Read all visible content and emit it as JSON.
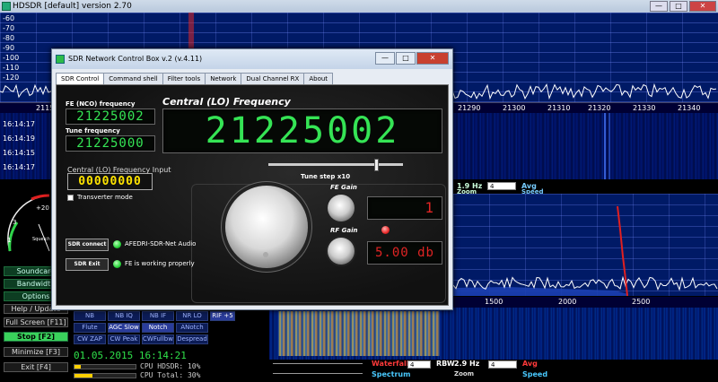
{
  "hdsdr": {
    "title": "HDSDR [default]  version 2.70",
    "db_labels": [
      "-60",
      "-70",
      "-80",
      "-90",
      "-100",
      "-110",
      "-120"
    ],
    "top_scale": [
      "2115",
      "21290",
      "21300",
      "21310",
      "21320",
      "21330",
      "21340"
    ],
    "wf_times": [
      "16:14:17",
      "16:14:19",
      "16:14:15",
      "16:14:17"
    ],
    "rbw_top": "1.9 Hz",
    "avg_label": "Avg",
    "zoom_label": "Zoom",
    "speed_label": "Speed",
    "bottom_scale": [
      "1500",
      "2000",
      "2500"
    ],
    "waterfall_label": "Waterfall",
    "spectrum_label": "Spectrum",
    "rbw_label": "RBW",
    "rbw_bottom": "2.9 Hz",
    "rbw_select": "4",
    "avg_select": "4",
    "small_select": "4"
  },
  "left_panel": {
    "buttons": [
      "Soundcard",
      "Bandwidth",
      "Options",
      "Help / Update",
      "Full Screen [F11]",
      "Stop [F2]",
      "Minimize [F3]",
      "Exit [F4]"
    ],
    "modes_row1": [
      "NB",
      "NB IQ",
      "NB IF",
      "NR LO",
      "RIF +5"
    ],
    "modes_row2": [
      "Flute",
      "AGC Slow",
      "Notch",
      "ANotch"
    ],
    "modes_row3": [
      "CW ZAP",
      "CW Peak",
      "CWFullbw",
      "Despread"
    ],
    "datetime": "01.05.2015 16:14:21",
    "cpu_hdsdr": "CPU HDSDR: 10%",
    "cpu_total": "CPU Total: 30%",
    "smeter_labels": [
      "1",
      "3",
      "+20",
      "Squelch"
    ],
    "cpu_hdsdr_pct": 10,
    "cpu_total_pct": 30
  },
  "dialog": {
    "title": "SDR Network Control Box v.2 (v.4.11)",
    "minimize": "—",
    "maximize": "□",
    "close": "✕",
    "tabs": [
      "SDR Control",
      "Command shell",
      "Filter tools",
      "Network",
      "Dual Channel RX",
      "About"
    ],
    "fe_label": "FE (NCO) frequency",
    "fe_value": "21225002",
    "tune_label": "Tune frequency",
    "tune_value": "21225000",
    "central_title": "Central (LO) Frequency",
    "central_value": "21225002",
    "tune_step": "Tune step x10",
    "input_label": "Central (LO) Frequency Input",
    "input_value": "00000000",
    "transverter": "Transverter mode",
    "fe_gain": "FE Gain",
    "rf_gain": "RF Gain",
    "fe_gain_value": "1",
    "rf_gain_value": "5.00 db",
    "sdr_connect": "SDR connect",
    "sdr_exit": "SDR Exit",
    "status1": "AFEDRI-SDR-Net Audio",
    "status2": "FE is working properly"
  },
  "colors": {
    "lcd_green": "#35e455",
    "lcd_red": "#e02424",
    "input_yellow": "#ffe400",
    "hdsdr_blue": "#001a66"
  }
}
